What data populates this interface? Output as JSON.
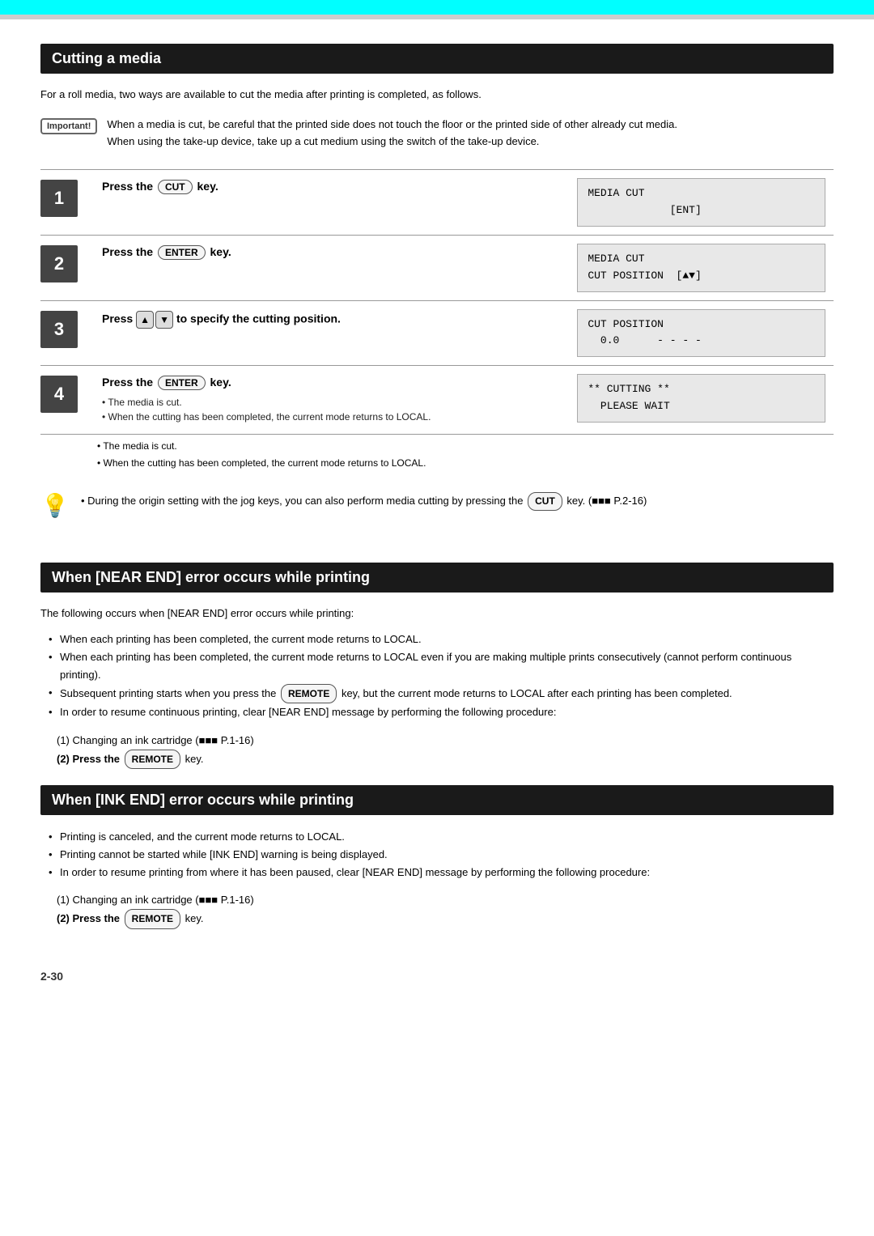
{
  "page": {
    "footer": "2-30"
  },
  "cutting_media": {
    "section_title": "Cutting a media",
    "intro": "For a roll media, two ways are available to cut the media after printing is completed, as follows.",
    "important_label": "Important!",
    "important_bullets": [
      "When a media is cut, be careful that the printed side does not touch the floor or the printed side of other already cut media.",
      "When using the take-up device, take up a cut medium using the switch of the take-up device."
    ],
    "steps": [
      {
        "number": "1",
        "instruction_prefix": "Press the",
        "key": "CUT",
        "instruction_suffix": "key.",
        "notes": [],
        "display_lines": [
          "MEDIA CUT",
          "                 [ENT]"
        ]
      },
      {
        "number": "2",
        "instruction_prefix": "Press the",
        "key": "ENTER",
        "instruction_suffix": "key.",
        "notes": [],
        "display_lines": [
          "MEDIA CUT",
          "CUT POSITION  [▲▼]"
        ]
      },
      {
        "number": "3",
        "instruction_prefix": "Press",
        "jog_keys": true,
        "instruction_suffix": "to specify the cutting position.",
        "notes": [],
        "display_lines": [
          "CUT POSITION",
          "  0.0      - - - -"
        ]
      },
      {
        "number": "4",
        "instruction_prefix": "Press the",
        "key": "ENTER",
        "instruction_suffix": "key.",
        "notes": [
          "• The media is cut.",
          "• When the cutting has been completed, the current mode returns to LOCAL."
        ],
        "display_lines": [
          "** CUTTING **",
          "  PLEASE WAIT"
        ]
      }
    ],
    "tip_text": "During the origin setting with the jog keys, you can also perform media cutting by pressing the CUT key. (■■■ P.2-16)"
  },
  "near_end": {
    "section_title": "When [NEAR END] error occurs while printing",
    "intro": "The following occurs when [NEAR END] error occurs while printing:",
    "bullets": [
      "When each printing has been completed, the current mode returns to LOCAL.",
      "When each printing has been completed, the current mode returns to LOCAL even if you are making multiple prints consecutively (cannot perform continuous printing).",
      "Subsequent printing starts when you press the REMOTE key, but the current mode returns to LOCAL after each printing has been completed.",
      "In order to resume continuous printing, clear [NEAR END] message by performing the following procedure:"
    ],
    "procedure": {
      "step1": "(1) Changing an ink cartridge (■■■ P.1-16)",
      "step2": "(2) Press the",
      "step2_key": "REMOTE",
      "step2_suffix": "key."
    }
  },
  "ink_end": {
    "section_title": "When [INK END] error occurs while printing",
    "bullets": [
      "Printing is canceled, and the current mode returns to LOCAL.",
      "Printing cannot be started while [INK END] warning is being displayed.",
      "In order to resume printing from where it has been paused, clear [NEAR END] message by performing the following procedure:"
    ],
    "procedure": {
      "step1": "(1) Changing an ink cartridge (■■■ P.1-16)",
      "step2": "(2) Press the",
      "step2_key": "REMOTE",
      "step2_suffix": "key."
    }
  }
}
